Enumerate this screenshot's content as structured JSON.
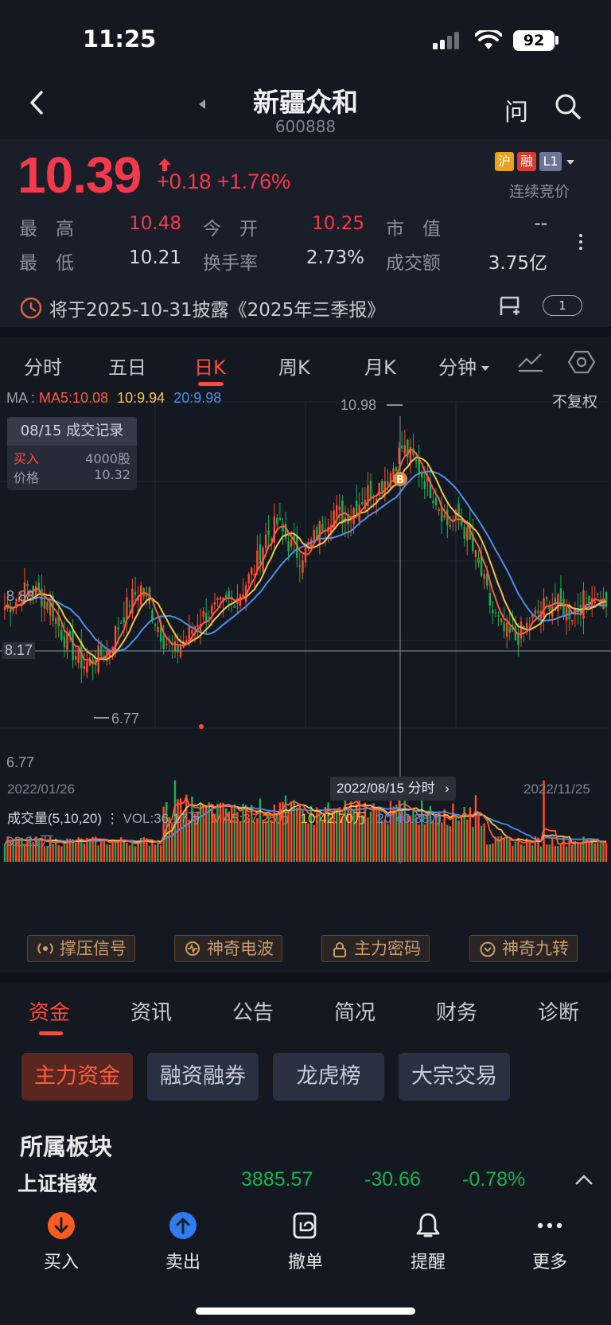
{
  "status_bar": {
    "time": "11:25",
    "battery": "92"
  },
  "header": {
    "name": "新疆众和",
    "code": "600888",
    "ask_label": "问"
  },
  "quote": {
    "price": "10.39",
    "change": "+0.18",
    "change_pct": "+1.76%",
    "badges": [
      "沪",
      "融",
      "L1"
    ],
    "auction_status": "连续竞价",
    "stats": [
      {
        "label": "最　高",
        "value": "10.48",
        "color": "#f5384b"
      },
      {
        "label": "今　开",
        "value": "10.25",
        "color": "#f5384b"
      },
      {
        "label": "市　值",
        "value": "--",
        "color": "#d8dbe2"
      },
      {
        "label": "最　低",
        "value": "10.21",
        "color": "#d8dbe2"
      },
      {
        "label": "换手率",
        "value": "2.73%",
        "color": "#d8dbe2"
      },
      {
        "label": "成交额",
        "value": "3.75亿",
        "color": "#d8dbe2"
      }
    ]
  },
  "notice": {
    "text": "将于2025-10-31披露《2025年三季报》",
    "count": "1"
  },
  "chart_tabs": [
    {
      "label": "分时"
    },
    {
      "label": "五日"
    },
    {
      "label": "日K"
    },
    {
      "label": "周K"
    },
    {
      "label": "月K"
    },
    {
      "label": "分钟"
    }
  ],
  "active_chart_tab": "日K",
  "kline": {
    "ma_prefix": "MA",
    "ma5": "MA5:10.08",
    "ma10": "10:9.94",
    "ma20": "20:9.98",
    "adjust": "不复权",
    "trade_record": {
      "title": "08/15 成交记录",
      "buy_label": "买入",
      "buy_qty": "4000股",
      "price_label": "价格",
      "price": "10.32"
    },
    "high_label": "10.98",
    "low_label": "6.77",
    "axis_top": "8.88",
    "axis_crosshair": "8.17",
    "axis_bottom": "6.77",
    "date_start": "2022/01/26",
    "date_end": "2022/11/25",
    "cursor_date": "2022/08/15 分时",
    "b_marker": "B",
    "colors": {
      "up": "#ff4a2e",
      "down": "#17b24f",
      "ma5": "#ff5a3c",
      "ma10": "#f2c44a",
      "ma20": "#4a90e8"
    }
  },
  "volume": {
    "title": "成交量(5,10,20)",
    "vol": "VOL:36.17万",
    "ma5": "MA5:37.25万",
    "ma10": "10:42.70万",
    "ma20": "20:40.88万",
    "max_label": "92.21万"
  },
  "chart_data": {
    "type": "candlestick",
    "x_range": [
      "2022/01/26",
      "2022/11/25"
    ],
    "ylim": [
      6.77,
      10.98
    ],
    "y_ticks": [
      8.88,
      6.77
    ],
    "crosshair_price": 8.17,
    "close_approx": [
      8.3,
      8.4,
      8.6,
      8.5,
      8.3,
      7.9,
      7.6,
      7.4,
      7.5,
      7.6,
      8.0,
      8.4,
      8.6,
      8.2,
      7.8,
      7.6,
      7.8,
      8.1,
      8.2,
      8.3,
      8.4,
      8.6,
      8.9,
      9.4,
      9.6,
      9.3,
      9.1,
      9.3,
      9.6,
      9.8,
      9.7,
      9.9,
      10.1,
      10.2,
      10.4,
      10.8,
      10.6,
      10.3,
      10.0,
      9.6,
      9.7,
      9.3,
      8.8,
      8.2,
      7.9,
      7.8,
      8.0,
      8.2,
      8.4,
      8.3,
      8.2,
      8.4,
      8.5,
      8.3
    ]
  },
  "signal_buttons": [
    "撑压信号",
    "神奇电波",
    "主力密码",
    "神奇九转"
  ],
  "bottom_tabs": [
    "资金",
    "资讯",
    "公告",
    "简况",
    "财务",
    "诊断"
  ],
  "fund_chips": [
    "主力资金",
    "融资融券",
    "龙虎榜",
    "大宗交易"
  ],
  "sector": {
    "title": "所属板块",
    "index_name": "上证指数",
    "index_value": "3885.57",
    "index_change": "-30.66",
    "index_pct": "-0.78%"
  },
  "toolbar": [
    {
      "label": "买入",
      "icon": "buy-icon"
    },
    {
      "label": "卖出",
      "icon": "sell-icon"
    },
    {
      "label": "撤单",
      "icon": "cancel-order-icon"
    },
    {
      "label": "提醒",
      "icon": "bell-icon"
    },
    {
      "label": "更多",
      "icon": "more-icon"
    }
  ]
}
